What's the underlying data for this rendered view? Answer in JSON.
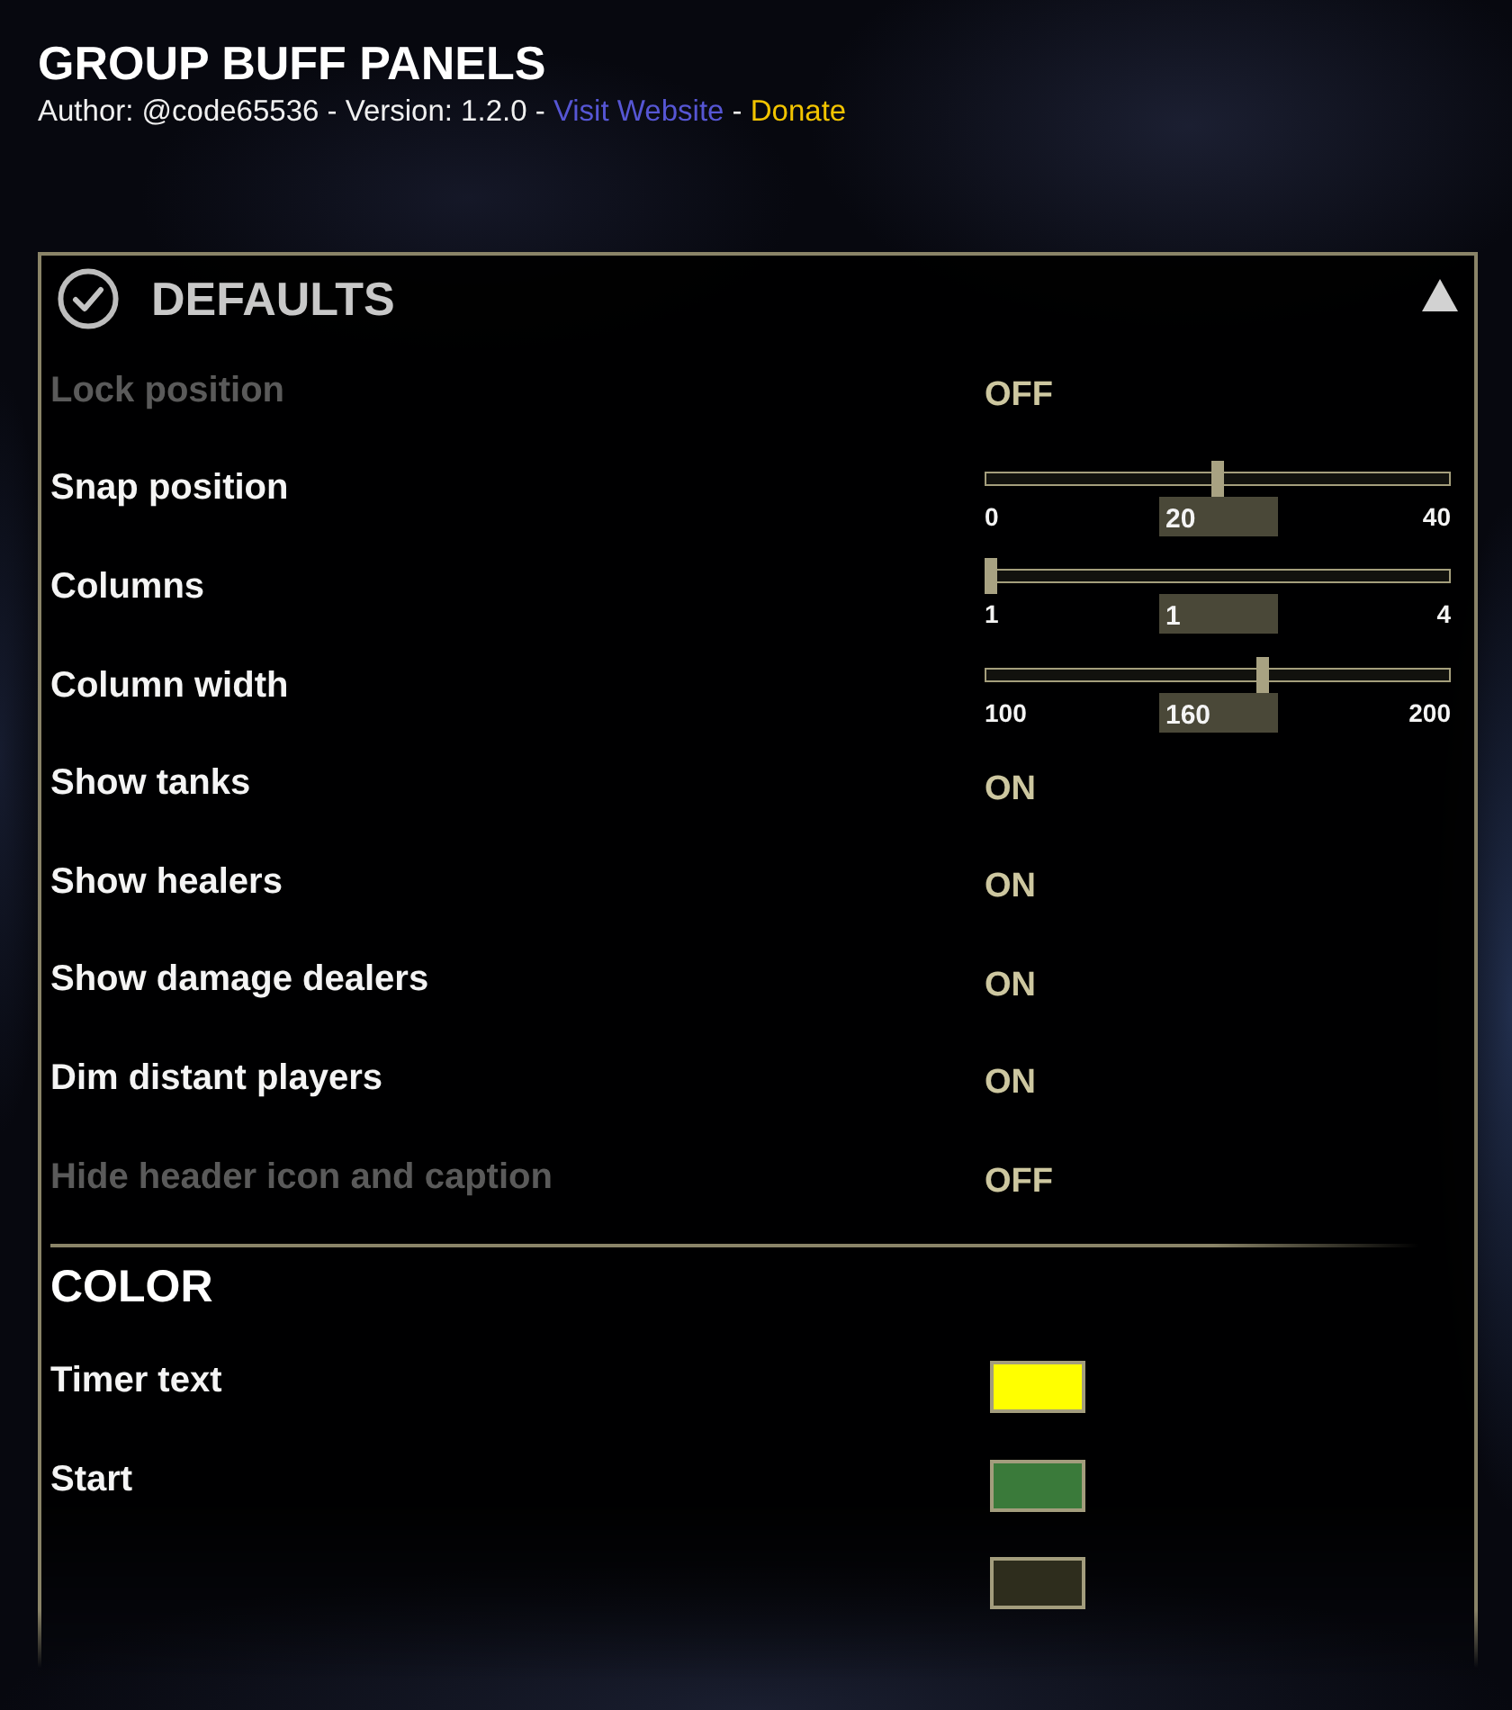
{
  "addon": {
    "title": "GROUP BUFF PANELS",
    "byline": [
      {
        "kind": "text",
        "text": "Author: @code65536 - Version: 1.2.0 -"
      },
      {
        "kind": "link",
        "text": "Visit Website",
        "color": "#5656d4"
      },
      {
        "kind": "text",
        "text": "-"
      },
      {
        "kind": "link",
        "text": "Donate",
        "color": "#f2c400"
      }
    ]
  },
  "submenu": {
    "title": "DEFAULTS",
    "expanded": true,
    "controls": [
      {
        "kind": "toggle",
        "label": "Lock position",
        "disabled": true,
        "value": "OFF"
      },
      {
        "kind": "slider",
        "label": "Snap position",
        "disabled": false,
        "min": "0",
        "max": "40",
        "value": "20",
        "level": 0.5
      },
      {
        "kind": "slider",
        "label": "Columns",
        "disabled": false,
        "min": "1",
        "max": "4",
        "value": "1",
        "level": 0
      },
      {
        "kind": "slider",
        "label": "Column width",
        "disabled": false,
        "min": "100",
        "max": "200",
        "value": "160",
        "level": 0.6
      },
      {
        "kind": "toggle",
        "label": "Show tanks",
        "disabled": false,
        "value": "ON"
      },
      {
        "kind": "toggle",
        "label": "Show healers",
        "disabled": false,
        "value": "ON"
      },
      {
        "kind": "toggle",
        "label": "Show damage dealers",
        "disabled": false,
        "value": "ON"
      },
      {
        "kind": "toggle",
        "label": "Dim distant players",
        "disabled": false,
        "value": "ON"
      },
      {
        "kind": "toggle",
        "label": "Hide header icon and caption",
        "disabled": true,
        "value": "OFF"
      },
      {
        "kind": "header",
        "label": "COLOR"
      },
      {
        "kind": "color",
        "label": "Timer text",
        "disabled": false,
        "color": "#ffff00"
      },
      {
        "kind": "color",
        "label": "Start",
        "disabled": false,
        "color": "#3a7a3a"
      },
      {
        "kind": "color",
        "disabled": false,
        "color": "#2e2d1d"
      }
    ]
  }
}
